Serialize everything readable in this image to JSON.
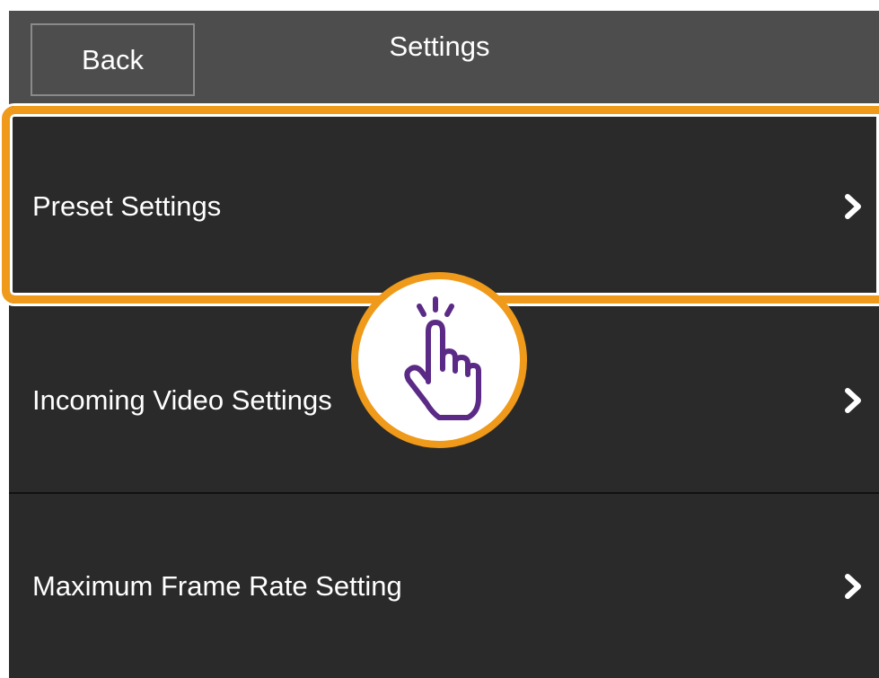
{
  "header": {
    "back_label": "Back",
    "title": "Settings"
  },
  "menu": {
    "items": [
      {
        "label": "Preset Settings",
        "icon": "chevron-right-icon"
      },
      {
        "label": "Incoming Video Settings",
        "icon": "chevron-right-icon"
      },
      {
        "label": "Maximum Frame Rate Setting",
        "icon": "chevron-right-icon"
      }
    ]
  },
  "overlay": {
    "highlight_color": "#ef9a1a",
    "tap_icon": "tap-gesture-icon",
    "tap_icon_color": "#5b2a86"
  }
}
